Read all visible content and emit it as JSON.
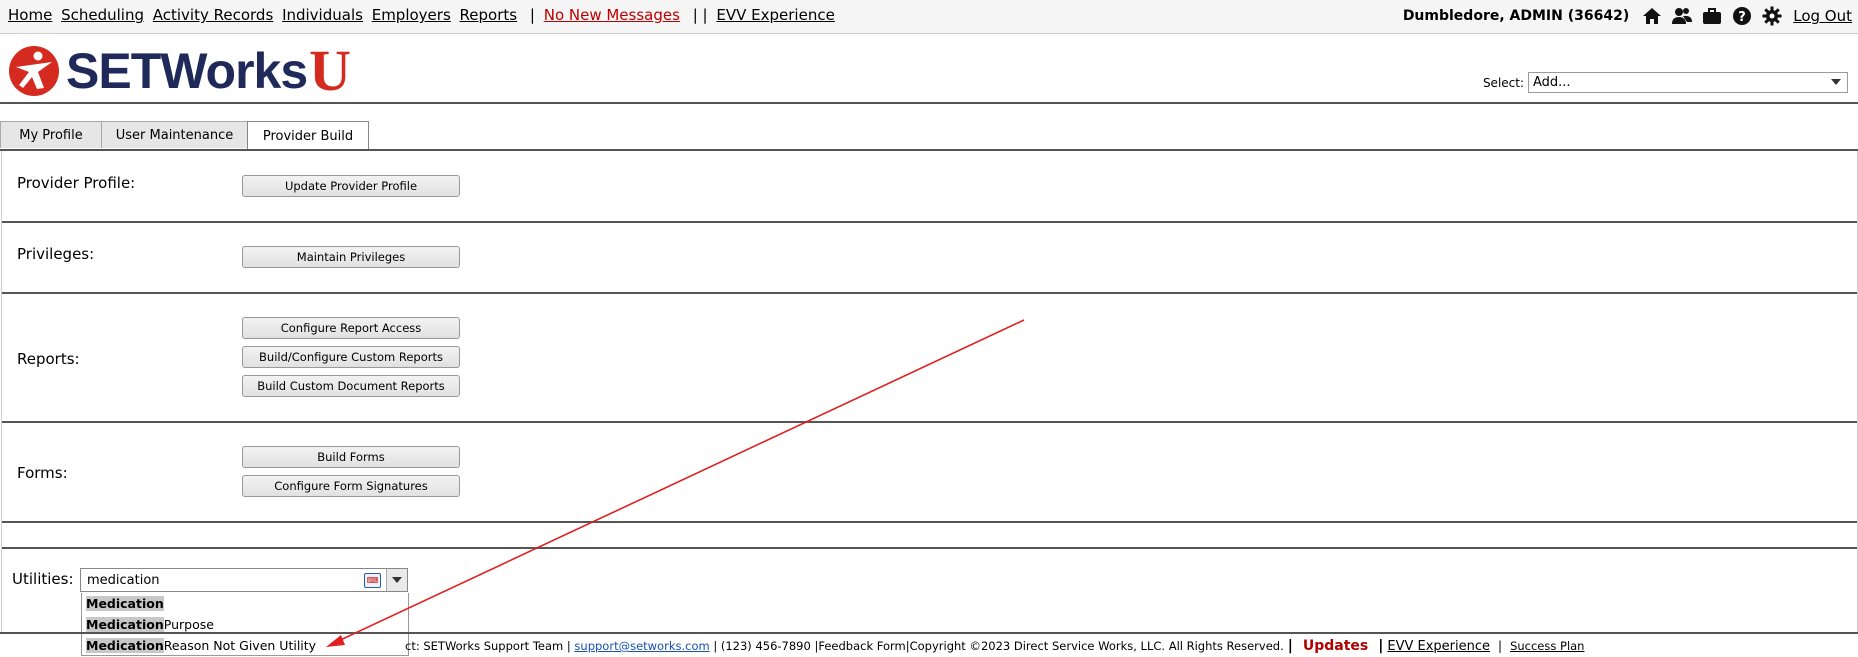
{
  "topnav": {
    "links": [
      "Home",
      "Scheduling",
      "Activity Records",
      "Individuals",
      "Employers",
      "Reports"
    ],
    "messages": "No New Messages",
    "evv": "EVV Experience",
    "user": "Dumbledore, ADMIN  (36642)",
    "logout": "Log Out",
    "icons": [
      "home-icon",
      "users-icon",
      "briefcase-icon",
      "help-icon",
      "gear-icon"
    ]
  },
  "header": {
    "logo_text": "SETWorks",
    "logo_u": "U",
    "select_label": "Select:",
    "select_value": "Add..."
  },
  "tabs": [
    "My Profile",
    "User Maintenance",
    "Provider Build"
  ],
  "active_tab": "Provider Build",
  "sections": {
    "provider_profile": {
      "label": "Provider Profile:",
      "buttons": [
        "Update Provider Profile"
      ]
    },
    "privileges": {
      "label": "Privileges:",
      "buttons": [
        "Maintain Privileges"
      ]
    },
    "reports": {
      "label": "Reports:",
      "buttons": [
        "Configure Report Access",
        "Build/Configure Custom Reports",
        "Build Custom Document Reports"
      ]
    },
    "forms": {
      "label": "Forms:",
      "buttons": [
        "Build Forms",
        "Configure Form Signatures"
      ]
    },
    "utilities": {
      "label": "Utilities:",
      "input_value": "medication",
      "suggestions": [
        {
          "match": "Medication",
          "rest": ""
        },
        {
          "match": "Medication",
          "rest": " Purpose"
        },
        {
          "match": "Medication",
          "rest": " Reason Not Given Utility"
        }
      ]
    }
  },
  "footer": {
    "contact": "ct: SETWorks Support Team |",
    "email": "support@setworks.com",
    "phone_copy": "| (123) 456-7890 |Feedback Form|Copyright ©2023 Direct Service Works, LLC. All Rights Reserved.",
    "updates": "Updates",
    "evv": "EVV Experience",
    "success": "Success Plan"
  },
  "colors": {
    "accent_red": "#d42a1f",
    "logo_navy": "#1f2a5a",
    "link_blue": "#1a4fb4",
    "annotation_arrow": "#e02020"
  }
}
